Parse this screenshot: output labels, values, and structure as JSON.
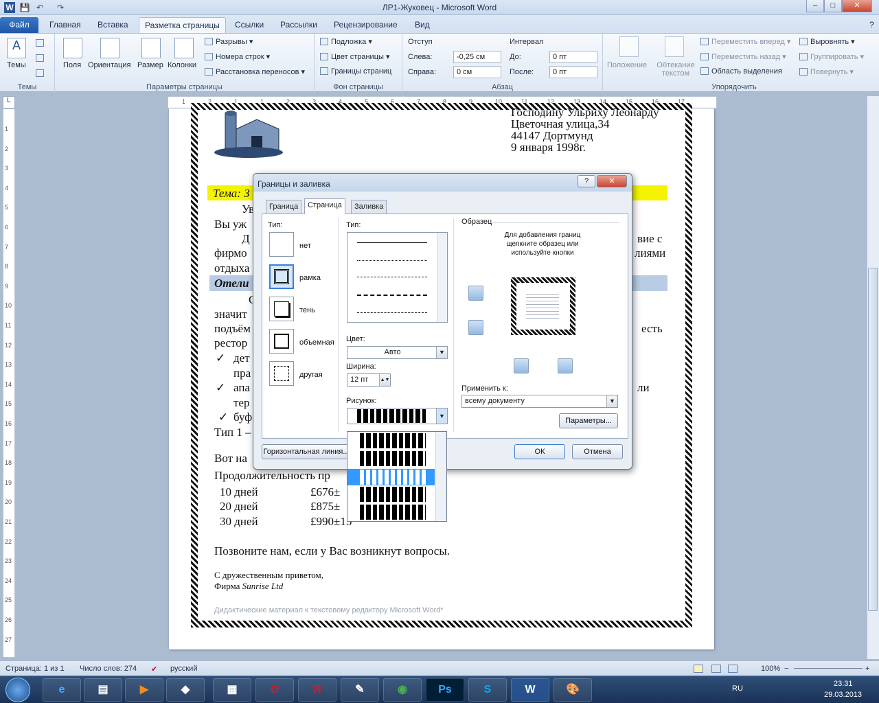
{
  "window": {
    "title": "ЛР1-Жуковец  -  Microsoft Word",
    "min": "–",
    "max": "□",
    "close": "✕",
    "app_letter": "W",
    "qa_save": "💾",
    "qa_undo": "↶",
    "qa_redo": "↷"
  },
  "tabs": {
    "file": "Файл",
    "home": "Главная",
    "insert": "Вставка",
    "layout": "Разметка страницы",
    "refs": "Ссылки",
    "mail": "Рассылки",
    "review": "Рецензирование",
    "view": "Вид",
    "help": "?"
  },
  "ribbon": {
    "themes": {
      "label": "Темы",
      "group": "Темы",
      "a": "A"
    },
    "page_setup": {
      "fields": "Поля",
      "orientation": "Ориентация",
      "size": "Размер",
      "columns": "Колонки",
      "breaks": "Разрывы ▾",
      "line_numbers": "Номера строк ▾",
      "hyphenation": "Расстановка переносов ▾",
      "group": "Параметры страницы"
    },
    "background": {
      "watermark": "Подложка ▾",
      "page_color": "Цвет страницы ▾",
      "page_borders": "Границы страниц",
      "group": "Фон страницы"
    },
    "paragraph": {
      "indent": "Отступ",
      "left": "Слева:",
      "left_val": "-0,25 см",
      "right": "Справа:",
      "right_val": "0 см",
      "spacing": "Интервал",
      "before": "До:",
      "before_val": "0 пт",
      "after": "После:",
      "after_val": "0 пт",
      "group": "Абзац"
    },
    "arrange": {
      "position": "Положение",
      "wrap": "Обтекание текстом",
      "forward": "Переместить вперед ▾",
      "backward": "Переместить назад ▾",
      "selection": "Область выделения",
      "align": "Выровнять ▾",
      "group_btn": "Группировать ▾",
      "rotate": "Повернуть ▾",
      "group": "Упорядочить"
    }
  },
  "ruler": {
    "h": [
      "1",
      "2",
      "1",
      "1",
      "2",
      "3",
      "4",
      "5",
      "6",
      "7",
      "8",
      "9",
      "10",
      "11",
      "12",
      "13",
      "14",
      "15",
      "16",
      "17"
    ],
    "v": [
      "1",
      "2",
      "3",
      "4",
      "5",
      "6",
      "7",
      "8",
      "9",
      "10",
      "11",
      "12",
      "13",
      "14",
      "15",
      "16",
      "17",
      "18",
      "19",
      "20",
      "21",
      "22",
      "23",
      "24",
      "25",
      "26",
      "27"
    ],
    "corner": "L"
  },
  "document": {
    "addr1": "Господину Ульриху Леонарду",
    "addr2": "Цветочная улица,34",
    "addr3": "44147 Дортмунд",
    "addr4": "9 января 1998г.",
    "theme": "Тема: З",
    "p1": "Ув",
    "p2": "Вы уж",
    "p3": "Д",
    "p3r": "вие  с",
    "p4": "фирмо",
    "p4r": "лиями",
    "p5": "отдыха",
    "hotel": "Отели",
    "p6": "С",
    "p7": "значит",
    "p8": "подъём",
    "p8r": "есть",
    "p9": "рестор",
    "check": "✓",
    "b1": "дет",
    "b1b": "пра",
    "b2": "апа",
    "b2r": "ли",
    "b2b": "тер",
    "b3": "буф",
    "type1": "Тип 1 –",
    "our": "Вот на",
    "duration": "Продолжительность пр",
    "d10": "10 дней",
    "d20": "20 дней",
    "d30": "30 дней",
    "pr10": "£676±",
    "pr20": "£875±",
    "pr30": "£990±15",
    "call": "Позвоните нам, если у Вас возникнут вопросы.",
    "regards": "С дружественным приветом,",
    "firm": "Фирма ",
    "firm_i": "Sunrise Ltd",
    "footer": "Дидактические  материал к текстовому редактору  Microsoft Word*"
  },
  "dialog": {
    "title": "Границы и заливка",
    "help": "?",
    "close": "✕",
    "tab_border": "Граница",
    "tab_page": "Страница",
    "tab_fill": "Заливка",
    "type_label": "Тип:",
    "types": [
      "нет",
      "рамка",
      "тень",
      "объемная",
      "другая"
    ],
    "style_label": "Тип:",
    "color_label": "Цвет:",
    "color_val": "Авто",
    "width_label": "Ширина:",
    "width_val": "12 пт",
    "art_label": "Рисунок:",
    "preview_label": "Образец",
    "preview_hint": "Для добавления границ щелкните образец или используйте кнопки",
    "apply_label": "Применить к:",
    "apply_val": "всему документу",
    "options": "Параметры...",
    "hline": "Горизонтальная линия...",
    "ok": "ОК",
    "cancel": "Отмена"
  },
  "status": {
    "page": "Страница: 1 из 1",
    "words": "Число слов: 274",
    "lang": "русский",
    "zoom": "100%",
    "minus": "−",
    "plus": "+"
  },
  "taskbar": {
    "lang": "RU",
    "time": "23:31",
    "date": "29.03.2013",
    "ps": "Ps",
    "word": "W",
    "opera": "O",
    "yandex": "Я",
    "skype": "S"
  }
}
